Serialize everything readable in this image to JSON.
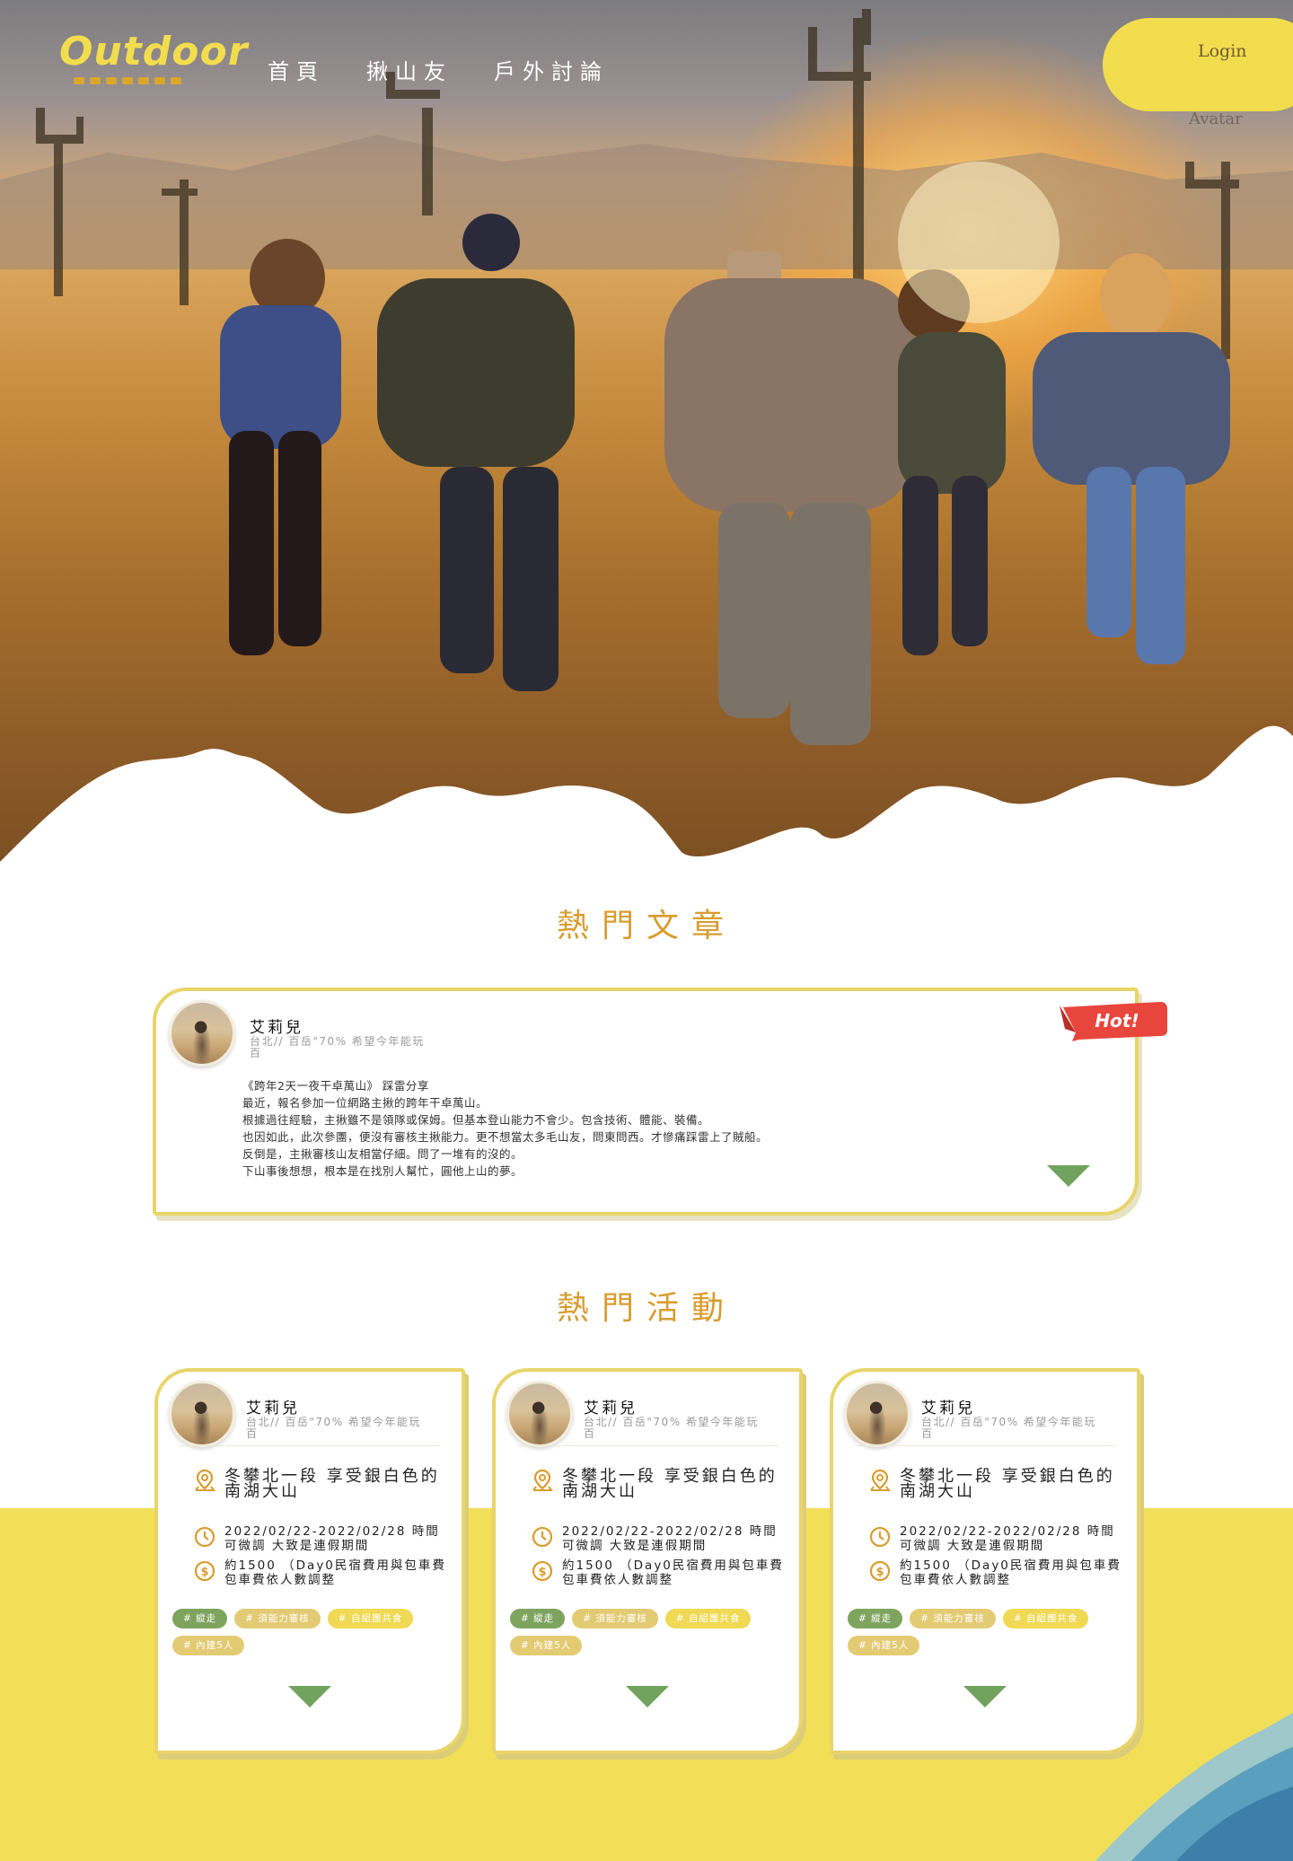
{
  "brand": {
    "logo_text": "Outdoor"
  },
  "nav": {
    "items": [
      "首頁",
      "揪山友",
      "戶外討論"
    ]
  },
  "header": {
    "login_label": "Login",
    "avatar_label": "Avatar"
  },
  "sections": {
    "articles_title": "熱門文章",
    "activities_title": "熱門活動"
  },
  "article": {
    "badge": "Hot!",
    "user": {
      "name": "艾莉兒",
      "bio": "台北// 百岳\"70% 希望今年能玩百"
    },
    "lines": [
      "《跨年2天一夜干卓萬山》 踩雷分享",
      "最近，報名參加一位網路主揪的跨年干卓萬山。",
      "根據過往經驗，主揪雖不是領隊或保姆。但基本登山能力不會少。包含技術、體能、裝備。",
      "也因如此，此次參團，便沒有審核主揪能力。更不想當太多毛山友，問東問西。才慘痛踩雷上了賊船。",
      "反倒是，主揪審核山友相當仔細。問了一堆有的沒的。",
      "下山事後想想，根本是在找別人幫忙，圓他上山的夢。"
    ]
  },
  "activities": [
    {
      "user": {
        "name": "艾莉兒",
        "bio": "台北// 百岳\"70% 希望今年能玩百"
      },
      "title": "冬攀北一段 享受銀白色的南湖大山",
      "date": "2022/02/22-2022/02/28 時間可微調 大致是連假期間",
      "cost": "約1500 （Day0民宿費用與包車費包車費依人數調整",
      "tags": [
        {
          "text": "# 縱走",
          "kind": "green"
        },
        {
          "text": "# 須能力審核",
          "kind": "tan"
        },
        {
          "text": "# 自組團共食",
          "kind": "yellow"
        },
        {
          "text": "# 內建5人",
          "kind": "tan"
        }
      ]
    },
    {
      "user": {
        "name": "艾莉兒",
        "bio": "台北// 百岳\"70% 希望今年能玩百"
      },
      "title": "冬攀北一段 享受銀白色的南湖大山",
      "date": "2022/02/22-2022/02/28 時間可微調 大致是連假期間",
      "cost": "約1500 （Day0民宿費用與包車費包車費依人數調整",
      "tags": [
        {
          "text": "# 縱走",
          "kind": "green"
        },
        {
          "text": "# 須能力審核",
          "kind": "tan"
        },
        {
          "text": "# 自組團共食",
          "kind": "yellow"
        },
        {
          "text": "# 內建5人",
          "kind": "tan"
        }
      ]
    },
    {
      "user": {
        "name": "艾莉兒",
        "bio": "台北// 百岳\"70% 希望今年能玩百"
      },
      "title": "冬攀北一段 享受銀白色的南湖大山",
      "date": "2022/02/22-2022/02/28 時間可微調 大致是連假期間",
      "cost": "約1500 （Day0民宿費用與包車費包車費依人數調整",
      "tags": [
        {
          "text": "# 縱走",
          "kind": "green"
        },
        {
          "text": "# 須能力審核",
          "kind": "tan"
        },
        {
          "text": "# 自組團共食",
          "kind": "yellow"
        },
        {
          "text": "# 內建5人",
          "kind": "tan"
        }
      ]
    }
  ],
  "colors": {
    "accent_yellow": "#f2dd4e",
    "title_gold": "#d89c2f",
    "arrow_green": "#72a35e",
    "hot_red": "#e8453c"
  },
  "icons": [
    "map-pin-icon",
    "clock-icon",
    "dollar-icon",
    "expand-arrow-icon"
  ]
}
